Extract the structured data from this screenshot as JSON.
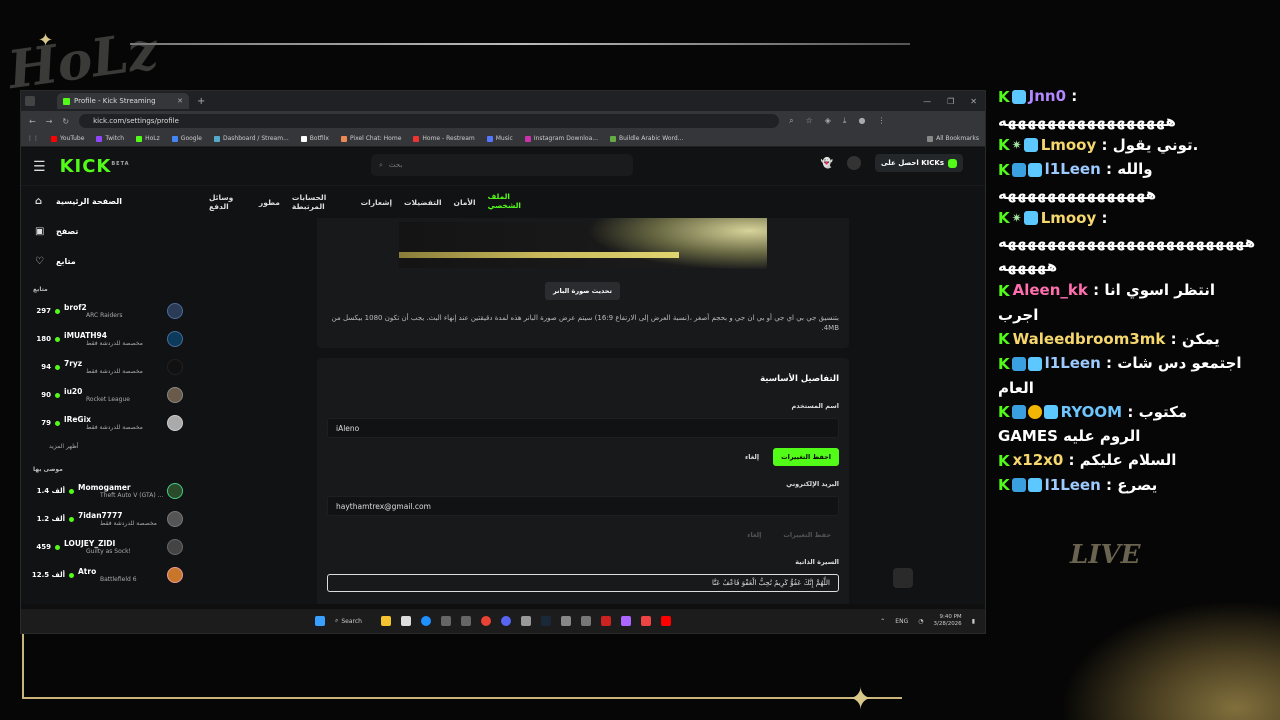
{
  "overlay": {
    "live_text": "LIVE"
  },
  "browser": {
    "tab_title": "Profile - Kick Streaming",
    "url": "kick.com/settings/profile",
    "bookmarks": [
      "YouTube",
      "Twitch",
      "HoLz",
      "Google",
      "Dashboard / Stream...",
      "Botfilx",
      "Pixel Chat: Home",
      "Home - Restream",
      "Music",
      "Instagram Downloa...",
      "Buildle Arabic Word..."
    ],
    "all_bookmarks": "All Bookmarks"
  },
  "kick": {
    "logo": "KICK",
    "logo_sup": "BETA",
    "search_placeholder": "بحث",
    "get_kicks": "احصل على KICKs",
    "sidebar": {
      "nav": [
        {
          "label": "الصفحة الرئيسية",
          "icon": "home-icon"
        },
        {
          "label": "تصفح",
          "icon": "browse-icon"
        },
        {
          "label": "متابع",
          "icon": "heart-icon"
        }
      ],
      "following_title": "متابع",
      "following": [
        {
          "count": "297",
          "name": "brof2",
          "category": "ARC Raiders"
        },
        {
          "count": "180",
          "name": "iMUATH94",
          "category": "مخصصة للدردشة فقط"
        },
        {
          "count": "94",
          "name": "7ryz",
          "category": "مخصصة للدردشة فقط"
        },
        {
          "count": "90",
          "name": "iu20",
          "category": "Rocket League"
        },
        {
          "count": "79",
          "name": "lReGix",
          "category": "مخصصة للدردشة فقط"
        }
      ],
      "show_more": "أظهر المزيد",
      "recommended_title": "موصى بها",
      "recommended": [
        {
          "count": "1.4 ألف",
          "name": "Momogamer",
          "category": "Theft Auto V (GTA) ..."
        },
        {
          "count": "1.2 ألف",
          "name": "7idan7777",
          "category": "مخصصة للدردشة فقط"
        },
        {
          "count": "459",
          "name": "LOUJEY_ZIDI",
          "category": "Guilty as Sock!"
        },
        {
          "count": "12.5 ألف",
          "name": "Atro",
          "category": "Battlefield 6"
        }
      ]
    },
    "tabs": [
      "الملف الشخصي",
      "الأمان",
      "التفضيلات",
      "إشعارات",
      "الحسابات المرتبطة",
      "مطور",
      "وسائل الدفع"
    ],
    "banner": {
      "update_button": "تحديث صورة البانر",
      "note": "بتنسيق جي بي اي جي أو بي ان جي و بحجم أصغر ،(نسبة العرض إلى الارتفاع 16:9) سيتم عرض صورة البانر هذه لمدة دقيقتين عند إنهاء البث. يجب أن تكون 1080 بيكسل من 4MB."
    },
    "basic": {
      "title": "التفاصيل الأساسية",
      "username_label": "اسم المستخدم",
      "username_value": "iAleno",
      "save_label": "احفظ التغييرات",
      "cancel_label": "إلغاء",
      "email_label": "البريد الإلكتروني",
      "email_value": "haythamtrex@gmail.com",
      "save2_label": "حفظ التغييرات",
      "cancel2_label": "إلغاء",
      "bio_label": "السيرة الذاتية",
      "bio_value": "اللَّهُمَّ إِنَّكَ عَفُوٌّ كَرِيمٌ تُحِبُّ الْعَفْوَ فَاعْفُ عَنَّا"
    }
  },
  "taskbar": {
    "search": "Search",
    "lang": "ENG",
    "time": "9:40 PM",
    "date": "3/28/2026"
  },
  "chat": [
    {
      "user": "Jnn0",
      "color": "#b388ff",
      "text": "",
      "line2": "هههههههههههههههههه",
      "badges": [
        "k",
        "b3"
      ]
    },
    {
      "user": "Lmooy",
      "color": "#f5d76e",
      "text": "توني يقول.",
      "badges": [
        "k",
        "spk",
        "b3"
      ]
    },
    {
      "user": "l1Leen",
      "color": "#9ecbff",
      "text": "والله",
      "line2": "هههههههههههههههه",
      "badges": [
        "k",
        "b2",
        "b3"
      ]
    },
    {
      "user": "Lmooy",
      "color": "#f5d76e",
      "text": "",
      "line2": "هههههههههههههههههههههههههه",
      "line3": "هههههه",
      "badges": [
        "k",
        "spk",
        "b3"
      ]
    },
    {
      "user": "Aleen_kk",
      "color": "#ff6fae",
      "text": "انتظر اسوي انا",
      "line2": "اجرب",
      "badges": [
        "k"
      ]
    },
    {
      "user": "Waleedbroom3mk",
      "color": "#f5d76e",
      "text": "يمكن",
      "badges": [
        "k"
      ]
    },
    {
      "user": "l1Leen",
      "color": "#9ecbff",
      "text": "اجتمعو دس شات",
      "line2": "العام",
      "badges": [
        "k",
        "b2",
        "b3"
      ]
    },
    {
      "user": "RYOOM",
      "color": "#6ec6ff",
      "text": "مكتوب",
      "line2": "GAMES الروم عليه",
      "badges": [
        "k",
        "b2",
        "b4",
        "b3"
      ]
    },
    {
      "user": "x12x0",
      "color": "#f5d76e",
      "text": "السلام عليكم",
      "badges": [
        "k"
      ]
    },
    {
      "user": "l1Leen",
      "color": "#9ecbff",
      "text": "يصرع",
      "badges": [
        "k",
        "b2",
        "b3"
      ]
    }
  ]
}
